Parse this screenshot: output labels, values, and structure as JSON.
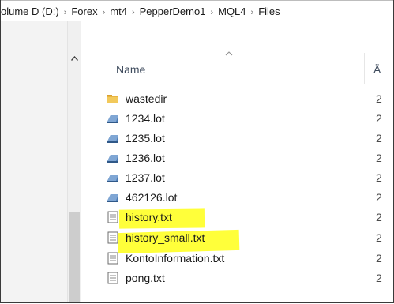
{
  "breadcrumb": {
    "items": [
      "olume D (D:)",
      "Forex",
      "mt4",
      "PepperDemo1",
      "MQL4",
      "Files"
    ],
    "separator": "›"
  },
  "columns": {
    "name": "Name",
    "date": "Ä"
  },
  "files": [
    {
      "name": "wastedir",
      "icon": "folder-icon",
      "date": "2"
    },
    {
      "name": "1234.lot",
      "icon": "disk-file-icon",
      "date": "2"
    },
    {
      "name": "1235.lot",
      "icon": "disk-file-icon",
      "date": "2"
    },
    {
      "name": "1236.lot",
      "icon": "disk-file-icon",
      "date": "2"
    },
    {
      "name": "1237.lot",
      "icon": "disk-file-icon",
      "date": "2"
    },
    {
      "name": "462126.lot",
      "icon": "disk-file-icon",
      "date": "2"
    },
    {
      "name": "history.txt",
      "icon": "text-file-icon",
      "date": "2",
      "highlighted": true
    },
    {
      "name": "history_small.txt",
      "icon": "text-file-icon",
      "date": "2",
      "highlighted": true
    },
    {
      "name": "KontoInformation.txt",
      "icon": "text-file-icon",
      "date": "2"
    },
    {
      "name": "pong.txt",
      "icon": "text-file-icon",
      "date": "2"
    }
  ],
  "colors": {
    "highlight": "#ffff3a",
    "folder": "#e8b441",
    "disk": "#3e6fa8"
  }
}
